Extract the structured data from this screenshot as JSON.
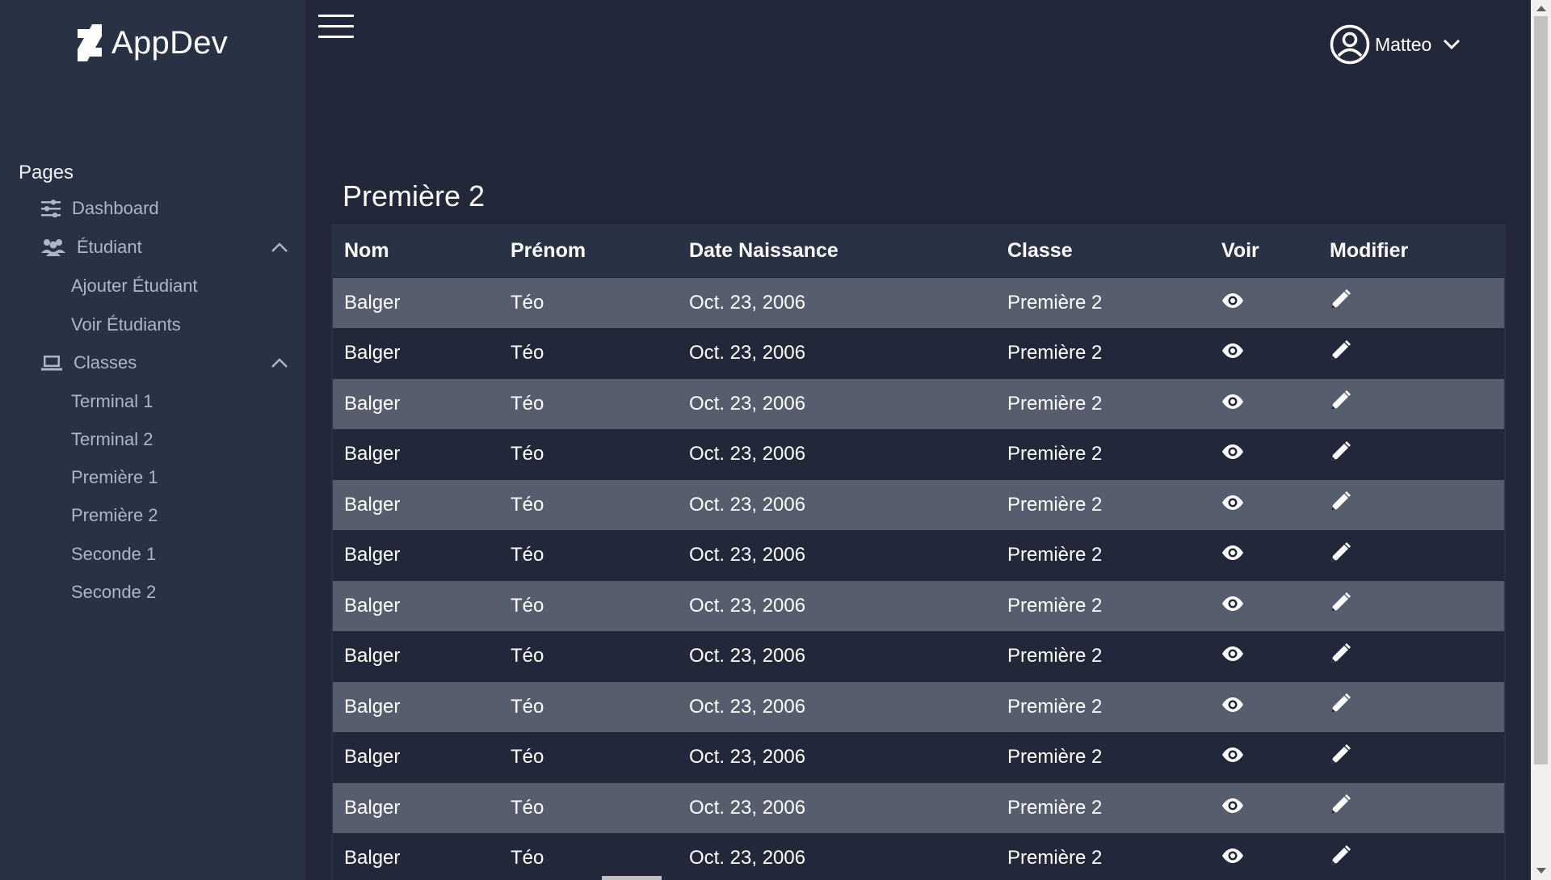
{
  "brand": {
    "name": "AppDev",
    "icon": "deviantart-logo-icon"
  },
  "sidebar": {
    "section_title": "Pages",
    "dashboard": {
      "label": "Dashboard",
      "icon": "sliders-icon"
    },
    "etudiant": {
      "label": "Étudiant",
      "icon": "users-icon",
      "items": [
        "Ajouter Étudiant",
        "Voir Étudiants"
      ]
    },
    "classes": {
      "label": "Classes",
      "icon": "laptop-icon",
      "items": [
        "Terminal 1",
        "Terminal 2",
        "Première 1",
        "Première 2",
        "Seconde 1",
        "Seconde 2"
      ]
    }
  },
  "topbar": {
    "user_name": "Matteo",
    "user_icon": "user-circle-icon",
    "menu_icon": "hamburger-menu-icon"
  },
  "page": {
    "title": "Première 2"
  },
  "table": {
    "headers": {
      "nom": "Nom",
      "prenom": "Prénom",
      "date": "Date Naissance",
      "classe": "Classe",
      "voir": "Voir",
      "modifier": "Modifier"
    },
    "rows": [
      {
        "nom": "Balger",
        "prenom": "Téo",
        "date": "Oct. 23, 2006",
        "classe": "Première 2"
      },
      {
        "nom": "Balger",
        "prenom": "Téo",
        "date": "Oct. 23, 2006",
        "classe": "Première 2"
      },
      {
        "nom": "Balger",
        "prenom": "Téo",
        "date": "Oct. 23, 2006",
        "classe": "Première 2"
      },
      {
        "nom": "Balger",
        "prenom": "Téo",
        "date": "Oct. 23, 2006",
        "classe": "Première 2"
      },
      {
        "nom": "Balger",
        "prenom": "Téo",
        "date": "Oct. 23, 2006",
        "classe": "Première 2"
      },
      {
        "nom": "Balger",
        "prenom": "Téo",
        "date": "Oct. 23, 2006",
        "classe": "Première 2"
      },
      {
        "nom": "Balger",
        "prenom": "Téo",
        "date": "Oct. 23, 2006",
        "classe": "Première 2"
      },
      {
        "nom": "Balger",
        "prenom": "Téo",
        "date": "Oct. 23, 2006",
        "classe": "Première 2"
      },
      {
        "nom": "Balger",
        "prenom": "Téo",
        "date": "Oct. 23, 2006",
        "classe": "Première 2"
      },
      {
        "nom": "Balger",
        "prenom": "Téo",
        "date": "Oct. 23, 2006",
        "classe": "Première 2"
      },
      {
        "nom": "Balger",
        "prenom": "Téo",
        "date": "Oct. 23, 2006",
        "classe": "Première 2"
      },
      {
        "nom": "Balger",
        "prenom": "Téo",
        "date": "Oct. 23, 2006",
        "classe": "Première 2"
      }
    ]
  },
  "colors": {
    "background": "#222839",
    "sidebar": "#293144",
    "row_alt": "#565e6e",
    "muted_text": "#aeb5c4"
  }
}
